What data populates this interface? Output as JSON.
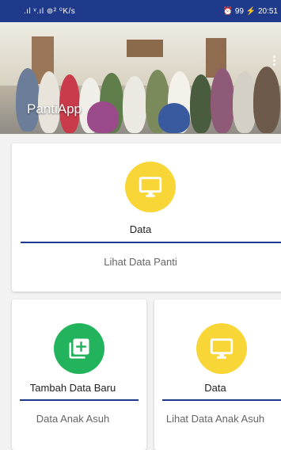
{
  "status_bar": {
    "left_text": ".ıl ᵛ.ıl ⊚² ⁰K/s",
    "right_text": "⏰ 99 ⚡ 20:51"
  },
  "header": {
    "app_title": "PantiApp",
    "menu_icon": "more-vert-icon"
  },
  "cards": {
    "main": {
      "icon": "monitor-icon",
      "icon_color": "#f9d637",
      "label": "Data",
      "subtitle": "Lihat Data Panti"
    },
    "left": {
      "icon": "add-library-icon",
      "icon_color": "#22b35c",
      "label": "Tambah Data Baru",
      "subtitle": "Data Anak Asuh"
    },
    "right": {
      "icon": "monitor-icon",
      "icon_color": "#f9d637",
      "label": "Data",
      "subtitle": "Lihat Data Anak Asuh"
    }
  },
  "colors": {
    "primary": "#1f3a8a",
    "accent_yellow": "#f9d637",
    "accent_green": "#22b35c"
  }
}
